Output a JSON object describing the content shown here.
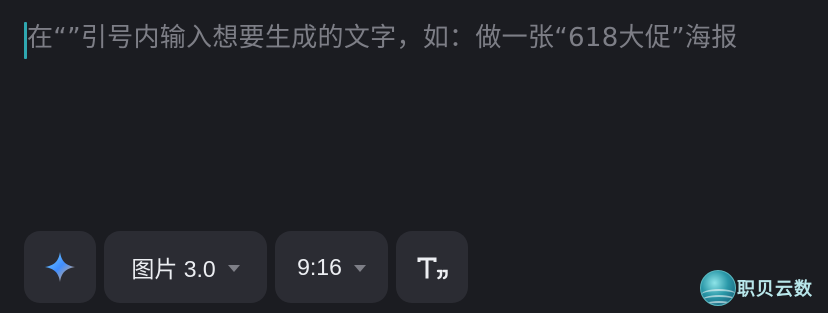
{
  "prompt": {
    "placeholder": "在“”引号内输入想要生成的文字，如：做一张“618大促”海报"
  },
  "toolbar": {
    "ai_icon": "sparkle-icon",
    "model_label": "图片 3.0",
    "ratio_label": "9:16",
    "text_icon": "text-quote-icon"
  },
  "watermark": {
    "name": "职贝云数"
  },
  "colors": {
    "background": "#1b1c21",
    "pill": "#2b2c33",
    "caret": "#2fa7b0",
    "placeholder": "#7d7e86"
  }
}
